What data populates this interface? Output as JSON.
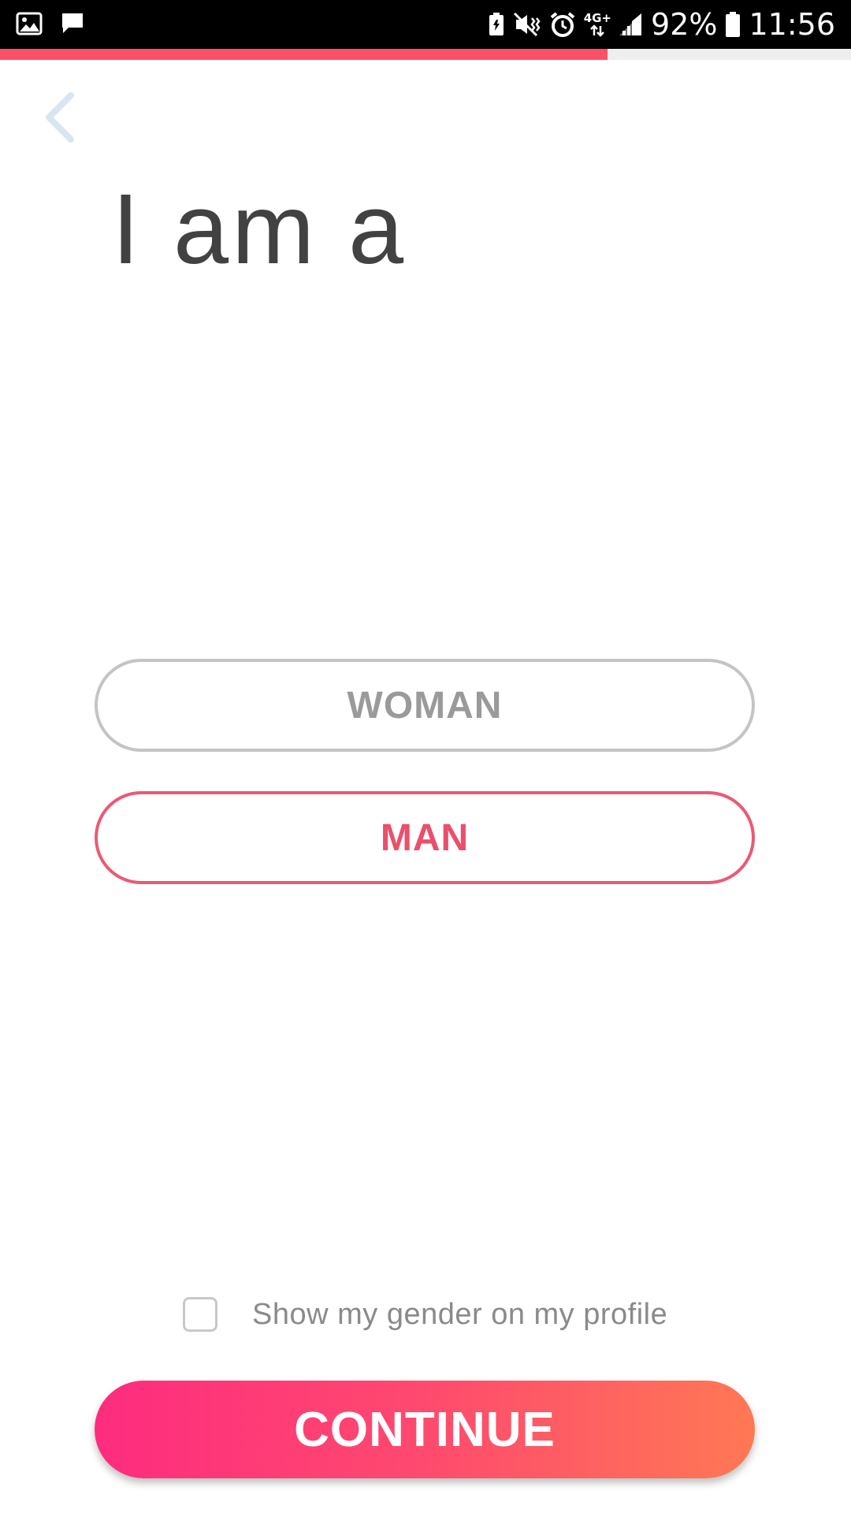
{
  "status_bar": {
    "network_label": "4G+",
    "battery_percent": "92%",
    "time": "11:56",
    "icons": [
      "gallery-icon",
      "message-icon",
      "battery-saver-icon",
      "mute-vibrate-icon",
      "alarm-icon",
      "network-4g-icon",
      "signal-icon",
      "battery-icon"
    ]
  },
  "progress": {
    "fraction": 0.714,
    "color": "#fd5068"
  },
  "back_icon": "chevron-left-icon",
  "title": "I am a",
  "options": {
    "woman": "WOMAN",
    "man": "MAN",
    "selected": "MAN"
  },
  "show_gender": {
    "label": "Show my gender on my profile",
    "checked": false
  },
  "continue_label": "CONTINUE",
  "colors": {
    "accent": "#ea4f6c",
    "gradient_start": "#fe2c7f",
    "gradient_end": "#ff7854",
    "back_icon": "#d8e6f2"
  }
}
